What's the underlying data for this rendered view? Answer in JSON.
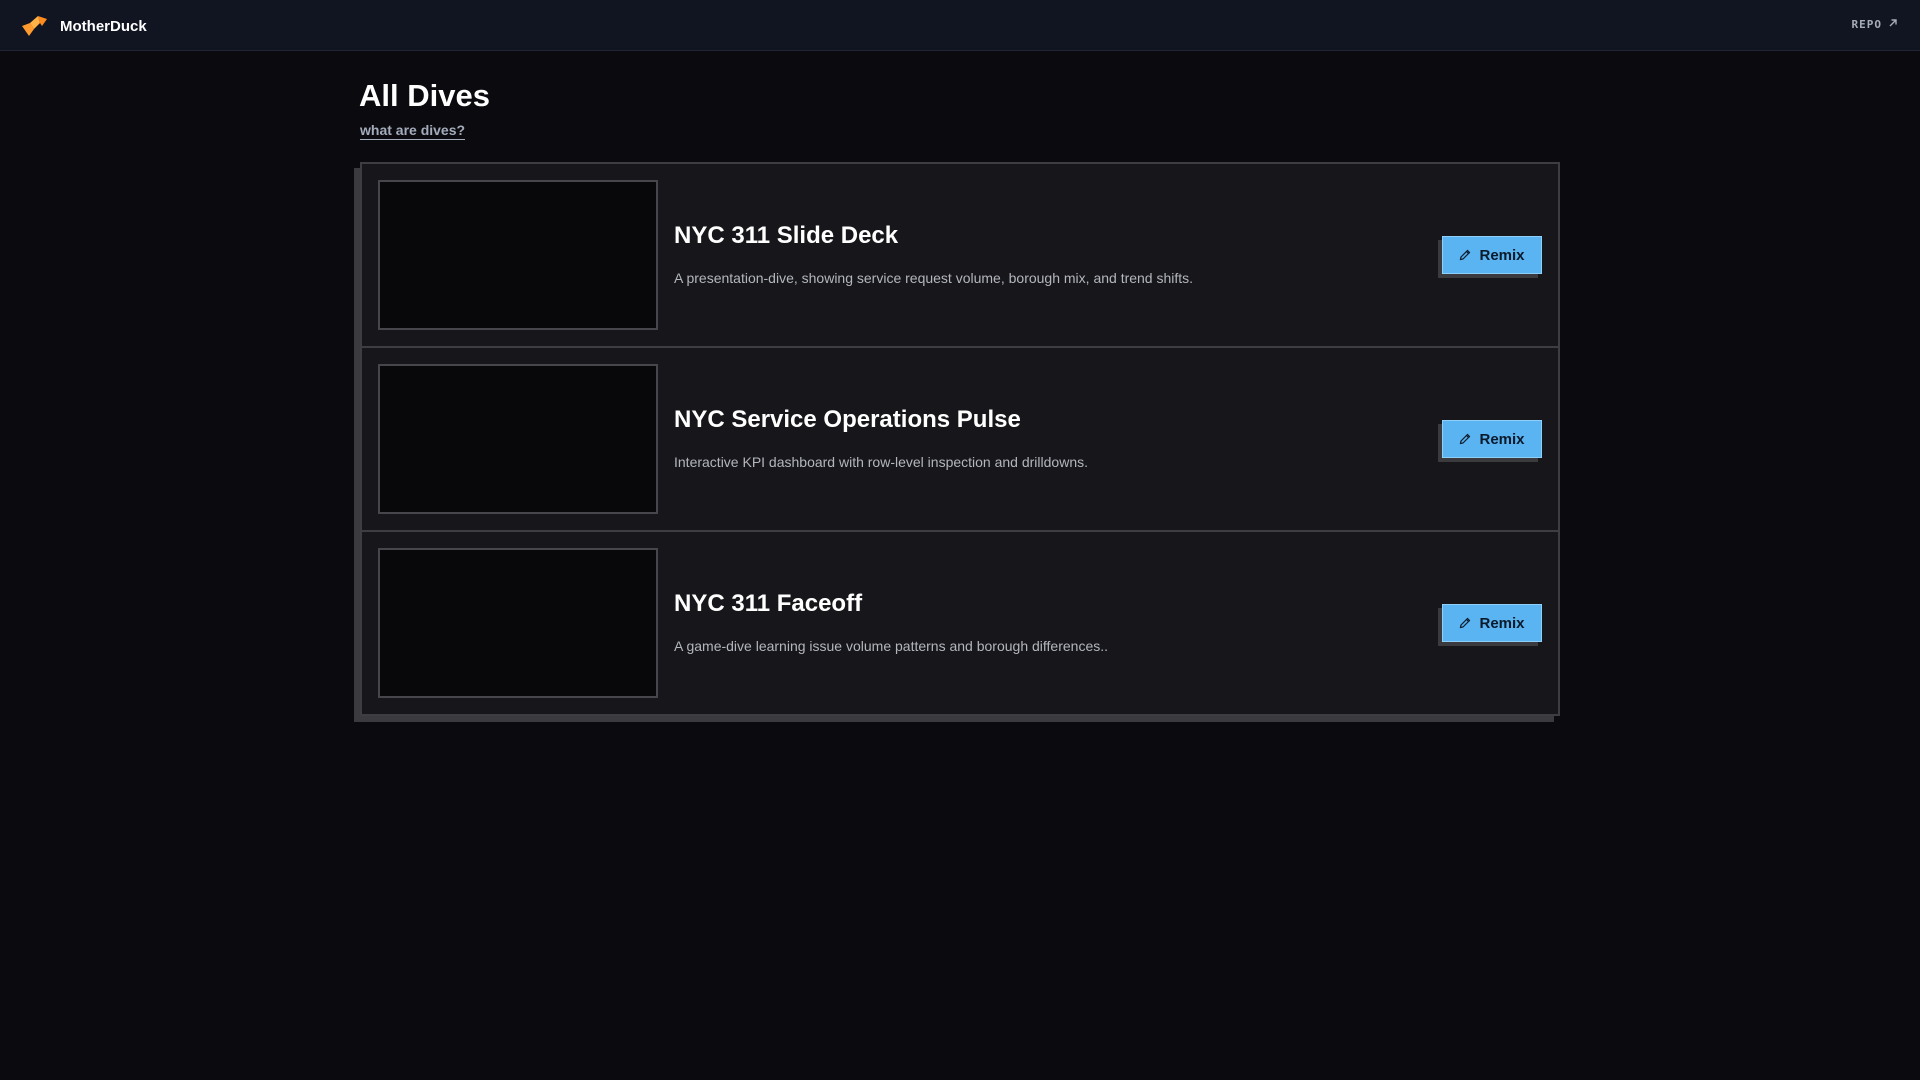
{
  "header": {
    "brand_name": "MotherDuck",
    "logo_icon": "motherduck-logo-icon",
    "repo_label": "REPO",
    "repo_icon": "external-arrow-icon"
  },
  "main": {
    "title": "All Dives",
    "help_link": "what are dives?",
    "dives": [
      {
        "title": "NYC 311 Slide Deck",
        "description": "A presentation-dive, showing service request volume, borough mix, and trend shifts.",
        "button_label": "Remix"
      },
      {
        "title": "NYC Service Operations Pulse",
        "description": "Interactive KPI dashboard with row-level inspection and drilldowns.",
        "button_label": "Remix"
      },
      {
        "title": "NYC 311 Faceoff",
        "description": "A game-dive learning issue volume patterns and borough differences..",
        "button_label": "Remix"
      }
    ]
  },
  "colors": {
    "background": "#0b0b0f",
    "header_bg": "#101521",
    "card_bg": "#17171b",
    "accent_button": "#5ab4f2",
    "logo_orange": "#ff9a2e"
  }
}
